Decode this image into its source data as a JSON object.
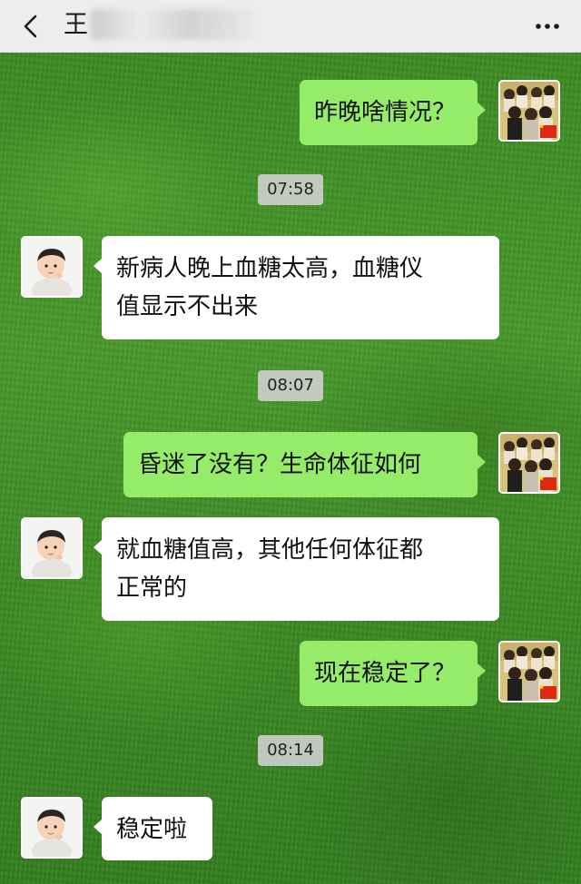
{
  "header": {
    "title": "王",
    "back_icon": "chevron-left-icon",
    "more_icon": "more-dots-icon"
  },
  "messages": [
    {
      "side": "right",
      "text": "昨晚啥情况？"
    },
    {
      "type": "time",
      "text": "07:58"
    },
    {
      "side": "left",
      "lines": [
        "新病人晚上血糖太高，血糖仪",
        "值显示不出来"
      ]
    },
    {
      "type": "time",
      "text": "08:07"
    },
    {
      "side": "right",
      "text": "昏迷了没有？生命体征如何"
    },
    {
      "side": "left",
      "lines": [
        "就血糖值高，其他任何体征都",
        "正常的"
      ]
    },
    {
      "side": "right",
      "text": "现在稳定了？"
    },
    {
      "type": "time",
      "text": "08:14"
    },
    {
      "side": "left",
      "text": "稳定啦"
    }
  ],
  "colors": {
    "outgoing_bubble": "#95ec69",
    "incoming_bubble": "#ffffff",
    "header_bg": "#ededed"
  }
}
